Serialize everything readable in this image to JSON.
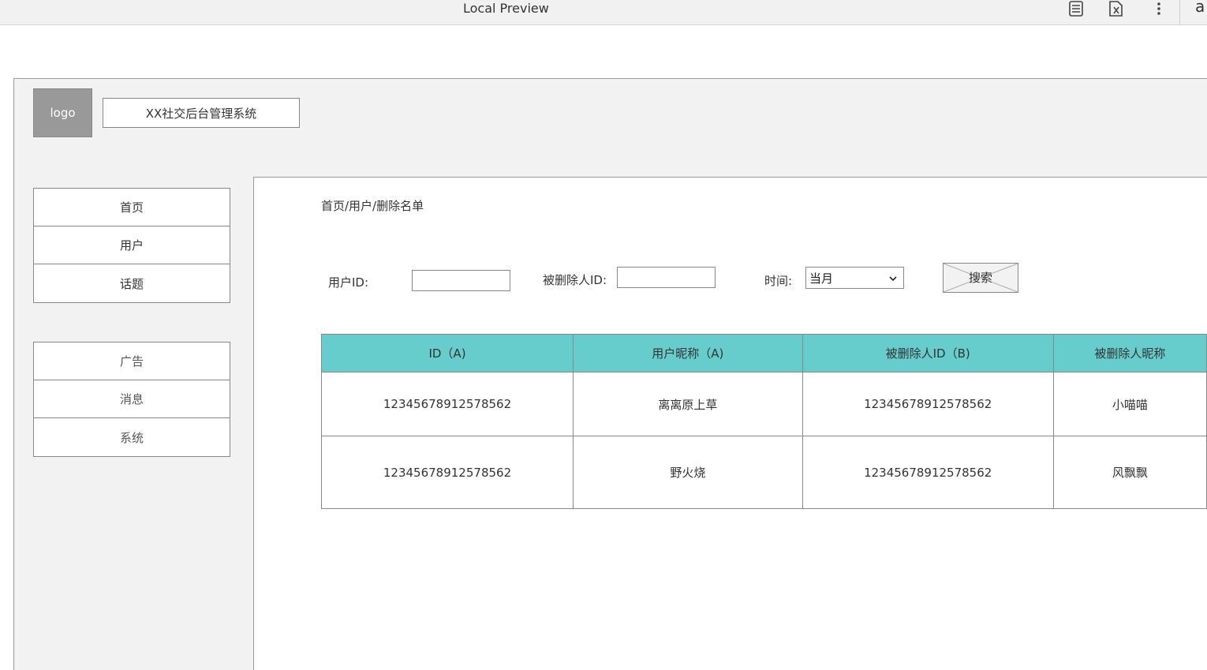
{
  "browser": {
    "title": "Local Preview",
    "icons": [
      "reader-mode-icon",
      "translate-icon",
      "more-vertical-icon"
    ],
    "overflow_char": "a"
  },
  "header": {
    "logo_label": "logo",
    "system_title": "XX社交后台管理系统"
  },
  "sidebar": {
    "group1": [
      {
        "label": "首页"
      },
      {
        "label": "用户"
      },
      {
        "label": "话题"
      }
    ],
    "group2": [
      {
        "label": "广告"
      },
      {
        "label": "消息"
      },
      {
        "label": "系统"
      }
    ]
  },
  "main": {
    "breadcrumb": "首页/用户/删除名单",
    "filters": {
      "user_id_label": "用户ID:",
      "user_id_value": "",
      "deleted_id_label": "被删除人ID:",
      "deleted_id_value": "",
      "time_label": "时间:",
      "time_selected": "当月",
      "search_label": "搜索"
    },
    "table": {
      "headers": [
        "ID（A)",
        "用户昵称（A)",
        "被删除人ID（B)",
        "被删除人昵称"
      ],
      "rows": [
        [
          "12345678912578562",
          "离离原上草",
          "12345678912578562",
          "小喵喵"
        ],
        [
          "12345678912578562",
          "野火烧",
          "12345678912578562",
          "风飘飘"
        ]
      ]
    }
  },
  "colors": {
    "table_header": "#66cccc",
    "canvas_bg": "#f2f2f2",
    "logo_bg": "#999999"
  }
}
